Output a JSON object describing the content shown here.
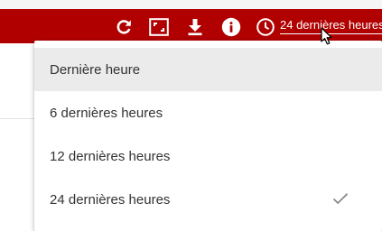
{
  "header": {
    "time_range_label": "24 dernières heures",
    "background_color": "#b00000",
    "icons": [
      "refresh-icon",
      "fullscreen-icon",
      "download-icon",
      "info-icon",
      "clock-icon"
    ]
  },
  "time_range_menu": {
    "items": [
      {
        "label": "Dernière heure",
        "highlighted": true,
        "selected": false
      },
      {
        "label": "6 dernières heures",
        "highlighted": false,
        "selected": false
      },
      {
        "label": "12 dernières heures",
        "highlighted": false,
        "selected": false
      },
      {
        "label": "24 dernières heures",
        "highlighted": false,
        "selected": true
      }
    ],
    "highlight_color": "#ebebeb",
    "check_icon": "check-icon"
  }
}
